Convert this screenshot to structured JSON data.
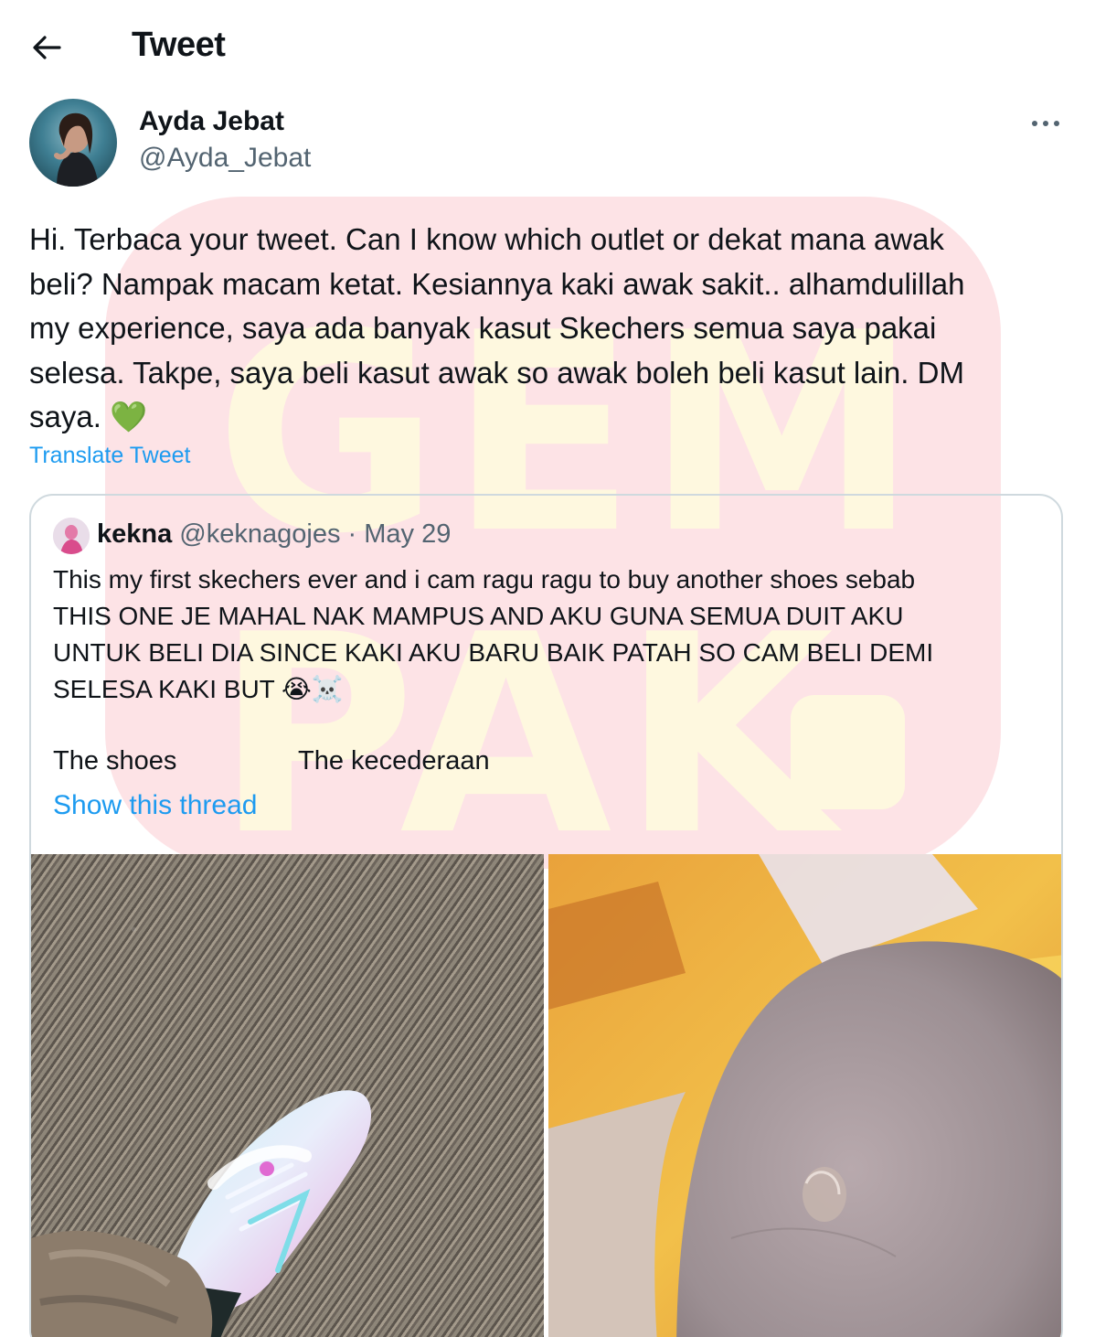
{
  "header": {
    "title": "Tweet"
  },
  "author": {
    "name": "Ayda Jebat",
    "handle": "@Ayda_Jebat"
  },
  "tweet": {
    "lines": [
      "Hi. Terbaca your tweet. Can I know which outlet or dekat mana awak",
      "beli? Nampak macam ketat. Kesiannya kaki awak sakit.. alhamdulillah",
      "my experience, saya ada banyak kasut Skechers semua saya pakai",
      "selesa. Takpe, saya beli kasut awak so awak boleh beli kasut lain. DM",
      "saya. 💚"
    ],
    "translate_label": "Translate Tweet"
  },
  "quoted": {
    "name": "kekna",
    "handle": "@keknagojes",
    "separator": "·",
    "date": "May 29",
    "lines": [
      "This my first skechers ever and i cam ragu ragu to buy another shoes sebab",
      "THIS ONE JE MAHAL NAK MAMPUS AND AKU GUNA SEMUA DUIT AKU",
      "UNTUK BELI DIA SINCE KAKI AKU BARU BAIK PATAH SO CAM BELI DEMI",
      "SELESA KAKI BUT 😭☠️"
    ],
    "label_left": "The shoes",
    "label_right": "The kecederaan",
    "thread_link": "Show this thread"
  },
  "watermark": {
    "line1": "GEM",
    "line2": "PAK"
  },
  "icons": {
    "back": "arrow-left-icon",
    "more": "more-horizontal-icon"
  },
  "colors": {
    "link": "#1d9bf0",
    "secondary_text": "#536471",
    "border": "#cfd9de",
    "watermark_bg": "#fde3e6",
    "watermark_fg": "#fef8df"
  }
}
